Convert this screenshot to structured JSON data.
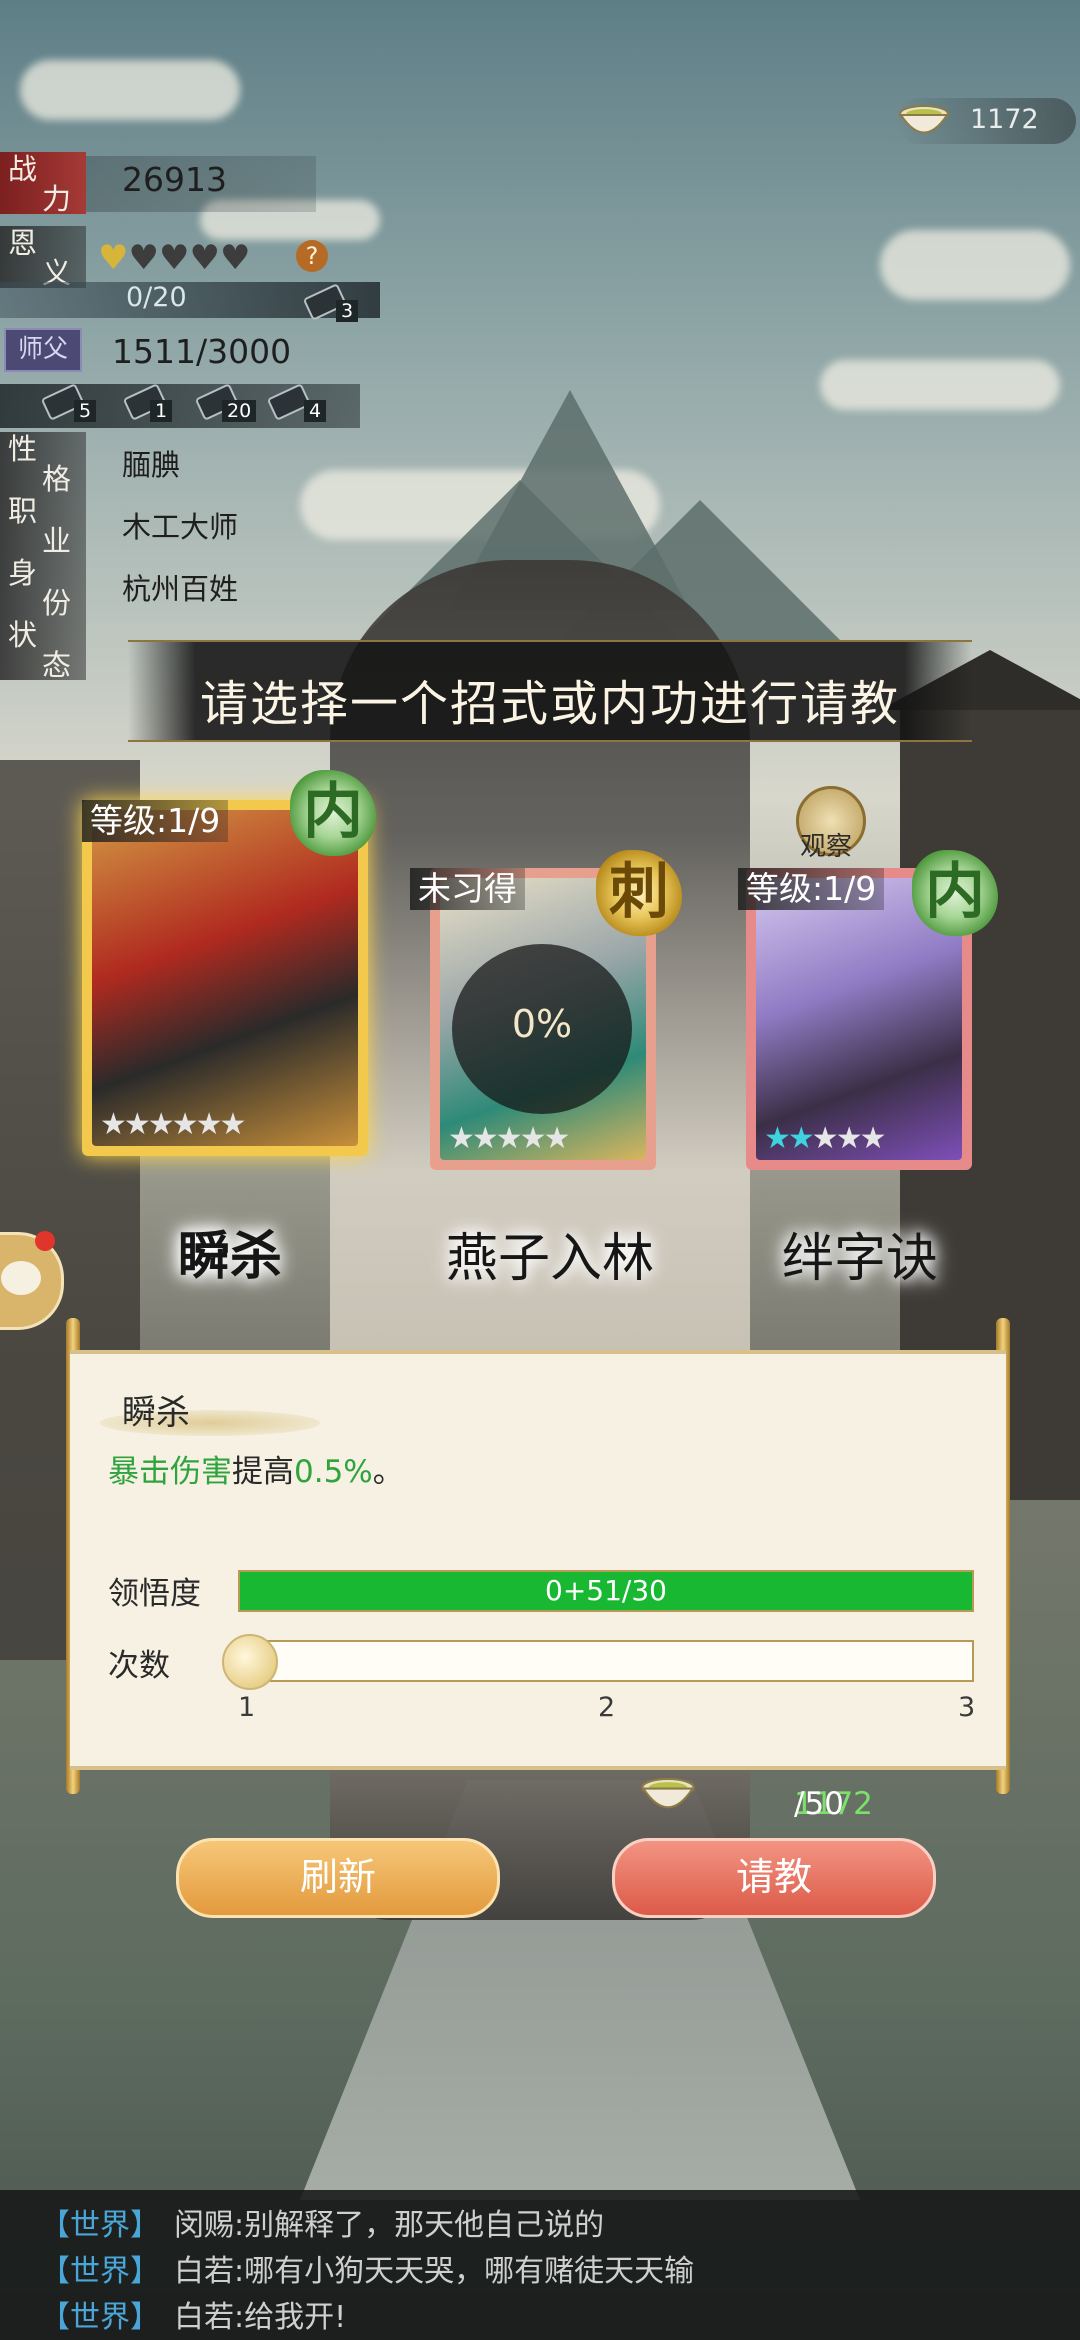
{
  "top_resource": {
    "icon": "tea-bowl-icon",
    "value": "1172"
  },
  "stats": {
    "power": {
      "label_a": "战",
      "label_b": "力",
      "value": "26913"
    },
    "favor": {
      "label_a": "恩",
      "label_b": "义",
      "hearts_filled": 1,
      "hearts_total": 5,
      "help": "?"
    },
    "favor_counter": {
      "value": "0/20",
      "item_count": "3"
    },
    "master": {
      "badge": "师父",
      "value": "1511/3000"
    },
    "item_counts": [
      "5",
      "1",
      "20",
      "4"
    ],
    "personality": {
      "label_a": "性",
      "label_b": "格",
      "value": "腼腆"
    },
    "job": {
      "label_a": "职",
      "label_b": "业",
      "value": "木工大师"
    },
    "identity": {
      "label_a": "身",
      "label_b": "份",
      "value": "杭州百姓"
    },
    "status": {
      "label_a": "状",
      "label_b": "态",
      "value": ""
    }
  },
  "banner": "请选择一个招式或内功进行请教",
  "observe_label": "观察",
  "cards": [
    {
      "name": "瞬杀",
      "level": "等级:1/9",
      "seal": "内",
      "stars_lit": 0,
      "stars_total": 6
    },
    {
      "name": "燕子入林",
      "level": "未习得",
      "seal": "刺",
      "progress": "0%",
      "stars_lit": 0,
      "stars_total": 5
    },
    {
      "name": "绊字诀",
      "level": "等级:1/9",
      "seal": "内",
      "stars_lit": 2,
      "stars_total": 5
    }
  ],
  "detail": {
    "title": "瞬杀",
    "desc_part1": "暴击伤害",
    "desc_part2": "提高",
    "desc_part3": "0.5%",
    "desc_part4": "。",
    "comprehension_label": "领悟度",
    "comprehension_text": "0+51/30",
    "comprehension_fill": 1.0,
    "times_label": "次数",
    "times_ticks": [
      "1",
      "2",
      "3"
    ],
    "times_value": 1
  },
  "cost": {
    "have": "1172",
    "need": "/50"
  },
  "buttons": {
    "refresh": "刷新",
    "ask": "请教"
  },
  "chat": [
    {
      "channel": "【世界】",
      "name": "闵赐:",
      "text": "别解释了，那天他自己说的"
    },
    {
      "channel": "【世界】",
      "name": "白若:",
      "text": "哪有小狗天天哭，哪有赌徒天天输"
    },
    {
      "channel": "【世界】",
      "name": "白若:",
      "text": "给我开!"
    }
  ],
  "colors": {
    "accent_green": "#18b832",
    "ask_button": "#dc5a48",
    "refresh_button": "#e39a3d",
    "chat_channel": "#4aa6d6"
  }
}
